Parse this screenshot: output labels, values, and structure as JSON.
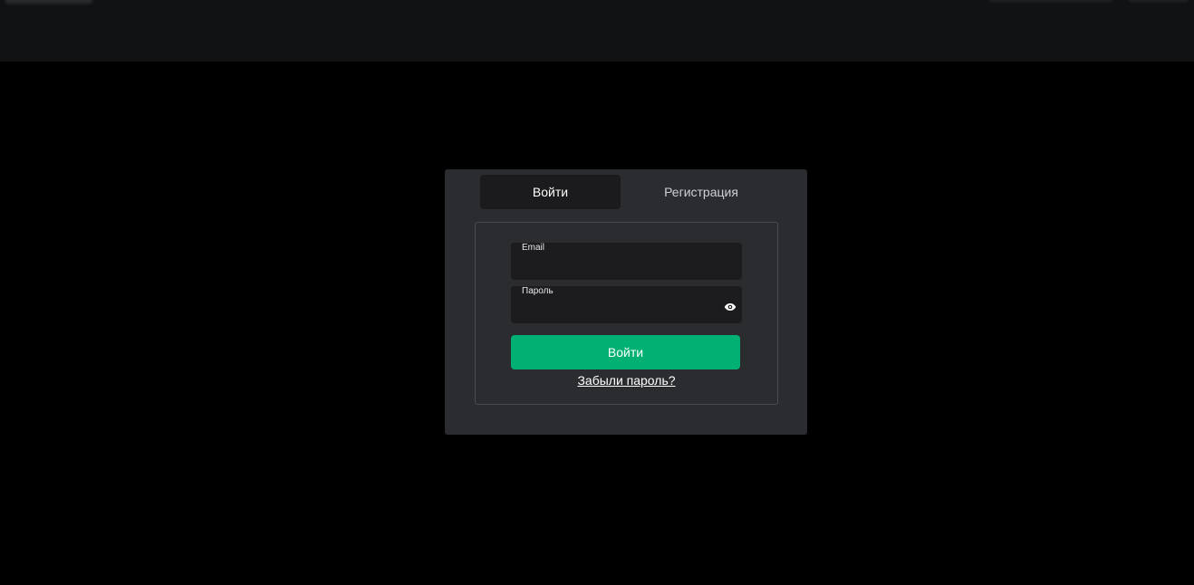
{
  "colors": {
    "page_background": "#000000",
    "header_background": "#111214",
    "modal_background": "#2b2c30",
    "field_background": "#1c1c1e",
    "accent_green": "#00b173",
    "text_primary": "#ffffff",
    "text_secondary": "#cfd0d3"
  },
  "auth_modal": {
    "tabs": [
      {
        "label": "Войти",
        "active": true
      },
      {
        "label": "Регистрация",
        "active": false
      }
    ],
    "email_field": {
      "label": "Email",
      "value": ""
    },
    "password_field": {
      "label": "Пароль",
      "value": "",
      "toggle_icon": "eye-icon"
    },
    "submit_label": "Войти",
    "forgot_password_label": "Забыли пароль?"
  }
}
